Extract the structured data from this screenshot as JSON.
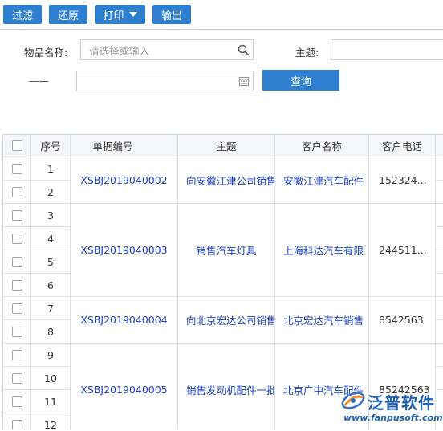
{
  "toolbar": {
    "filter": "过滤",
    "reset": "还原",
    "print": "打印",
    "export": "输出"
  },
  "form": {
    "item_label": "物品名称:",
    "item_placeholder": "请选择或输入",
    "subject_label": "主题:",
    "date_dash": "——",
    "query": "查询"
  },
  "table": {
    "headers": {
      "seq": "序号",
      "doc_no": "单据编号",
      "subject": "主题",
      "customer": "客户名称",
      "phone": "客户电话"
    },
    "seq": [
      "1",
      "2",
      "3",
      "4",
      "5",
      "6",
      "7",
      "8",
      "9",
      "10",
      "11",
      "12"
    ],
    "groups": [
      {
        "doc_no": "XSBJ2019040002",
        "subject": "向安徽江津公司销售",
        "customer": "安徽江津汽车配件",
        "phone": "152324..."
      },
      {
        "doc_no": "XSBJ2019040003",
        "subject": "销售汽车灯具",
        "customer": "上海科达汽车有限",
        "phone": "244511..."
      },
      {
        "doc_no": "XSBJ2019040004",
        "subject": "向北京宏达公司销售",
        "customer": "北京宏达汽车销售",
        "phone": "8542563"
      },
      {
        "doc_no": "XSBJ2019040005",
        "subject": "销售发动机配件一批",
        "customer": "北京广中汽车配件",
        "phone": "85242563"
      }
    ]
  },
  "watermark": {
    "brand": "泛普软件",
    "url": "www.fanpusoft.com"
  },
  "colors": {
    "primary": "#2f7fd0",
    "link": "#1a3fc4",
    "highlight": "#e03030"
  }
}
